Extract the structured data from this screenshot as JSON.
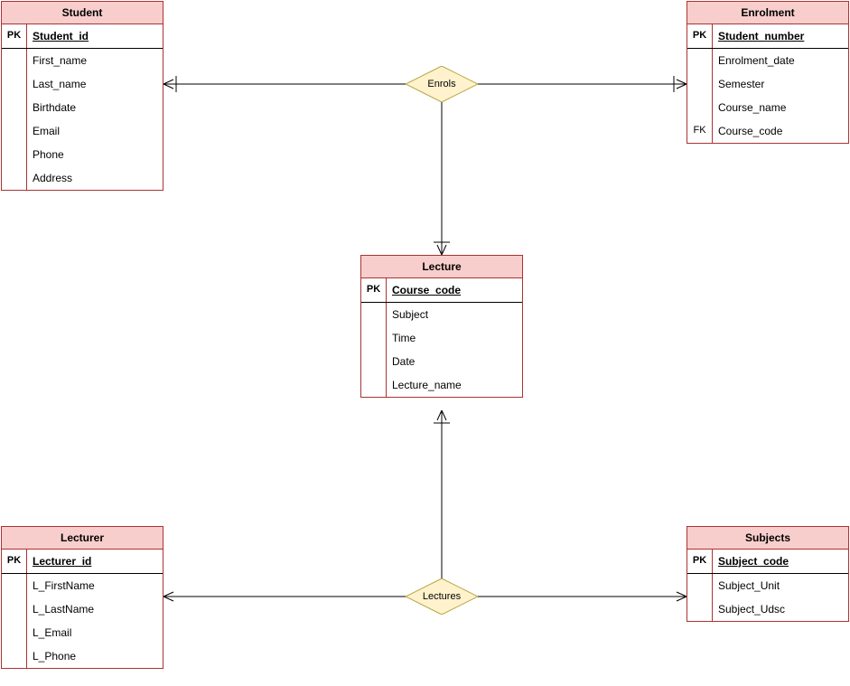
{
  "entities": {
    "student": {
      "title": "Student",
      "pk_label": "PK",
      "pk": "Student_id",
      "attrs": [
        "First_name",
        "Last_name",
        "Birthdate",
        "Email",
        "Phone",
        "Address"
      ]
    },
    "enrolment": {
      "title": "Enrolment",
      "pk_label": "PK",
      "pk": "Student_number",
      "attrs": [
        "Enrolment_date",
        "Semester",
        "Course_name"
      ],
      "fk_label": "FK",
      "fk": "Course_code"
    },
    "lecture": {
      "title": "Lecture",
      "pk_label": "PK",
      "pk": "Course_code",
      "attrs": [
        "Subject",
        "Time",
        "Date",
        "Lecture_name"
      ]
    },
    "lecturer": {
      "title": "Lecturer",
      "pk_label": "PK",
      "pk": "Lecturer_id",
      "attrs": [
        "L_FirstName",
        "L_LastName",
        "L_Email",
        "L_Phone"
      ]
    },
    "subjects": {
      "title": "Subjects",
      "pk_label": "PK",
      "pk": "Subject_code",
      "attrs": [
        "Subject_Unit",
        "Subject_Udsc"
      ]
    }
  },
  "relationships": {
    "enrols": "Enrols",
    "lectures": "Lectures"
  }
}
